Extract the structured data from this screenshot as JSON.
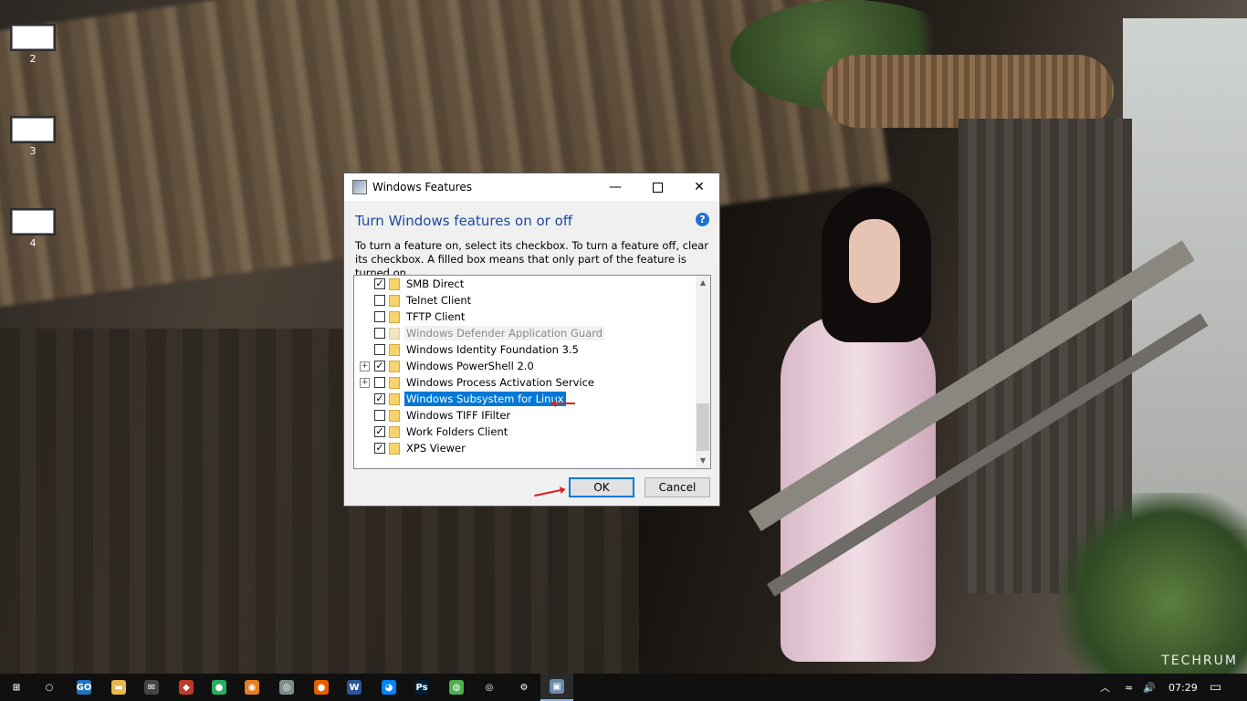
{
  "desktop": {
    "icons": [
      {
        "label": "2"
      },
      {
        "label": "3"
      },
      {
        "label": "4"
      }
    ],
    "watermark": "TECHRUM"
  },
  "dialog": {
    "title": "Windows Features",
    "heading": "Turn Windows features on or off",
    "help": "?",
    "description": "To turn a feature on, select its checkbox. To turn a feature off, clear its checkbox. A filled box means that only part of the feature is turned on.",
    "features": [
      {
        "label": "SMB Direct",
        "checked": true,
        "expander": false,
        "state": "normal"
      },
      {
        "label": "Telnet Client",
        "checked": false,
        "expander": false,
        "state": "normal"
      },
      {
        "label": "TFTP Client",
        "checked": false,
        "expander": false,
        "state": "normal"
      },
      {
        "label": "Windows Defender Application Guard",
        "checked": false,
        "expander": false,
        "state": "disabled"
      },
      {
        "label": "Windows Identity Foundation 3.5",
        "checked": false,
        "expander": false,
        "state": "normal"
      },
      {
        "label": "Windows PowerShell 2.0",
        "checked": true,
        "expander": true,
        "state": "normal"
      },
      {
        "label": "Windows Process Activation Service",
        "checked": false,
        "expander": true,
        "state": "normal"
      },
      {
        "label": "Windows Subsystem for Linux",
        "checked": true,
        "expander": false,
        "state": "selected"
      },
      {
        "label": "Windows TIFF IFilter",
        "checked": false,
        "expander": false,
        "state": "normal"
      },
      {
        "label": "Work Folders Client",
        "checked": true,
        "expander": false,
        "state": "normal"
      },
      {
        "label": "XPS Viewer",
        "checked": true,
        "expander": false,
        "state": "normal"
      }
    ],
    "ok_label": "OK",
    "cancel_label": "Cancel"
  },
  "taskbar": {
    "apps": [
      {
        "name": "start-button",
        "glyph": "⊞",
        "color": "#101010"
      },
      {
        "name": "cortana-button",
        "glyph": "○",
        "color": "#101010"
      },
      {
        "name": "gotv-app",
        "glyph": "GO",
        "color": "#1e73be"
      },
      {
        "name": "file-explorer",
        "glyph": "▬",
        "color": "#e8b84a"
      },
      {
        "name": "mail-app",
        "glyph": "✉",
        "color": "#444444"
      },
      {
        "name": "app-6",
        "glyph": "◆",
        "color": "#c0392b"
      },
      {
        "name": "app-7",
        "glyph": "●",
        "color": "#27ae60"
      },
      {
        "name": "app-8",
        "glyph": "◉",
        "color": "#e67e22"
      },
      {
        "name": "app-9",
        "glyph": "◎",
        "color": "#7f8c8d"
      },
      {
        "name": "firefox",
        "glyph": "●",
        "color": "#e66000"
      },
      {
        "name": "word",
        "glyph": "W",
        "color": "#2b579a"
      },
      {
        "name": "messenger",
        "glyph": "◕",
        "color": "#0084ff"
      },
      {
        "name": "photoshop",
        "glyph": "Ps",
        "color": "#001e36"
      },
      {
        "name": "chrome",
        "glyph": "◍",
        "color": "#4caf50"
      },
      {
        "name": "groove",
        "glyph": "◎",
        "color": "#101010"
      },
      {
        "name": "settings",
        "glyph": "⚙",
        "color": "#101010"
      },
      {
        "name": "windows-features",
        "glyph": "▣",
        "color": "#6d8aa8"
      }
    ],
    "time": "07:29",
    "volume": "🔊",
    "network": "≈",
    "chevron": "︿",
    "notification": "▭"
  }
}
